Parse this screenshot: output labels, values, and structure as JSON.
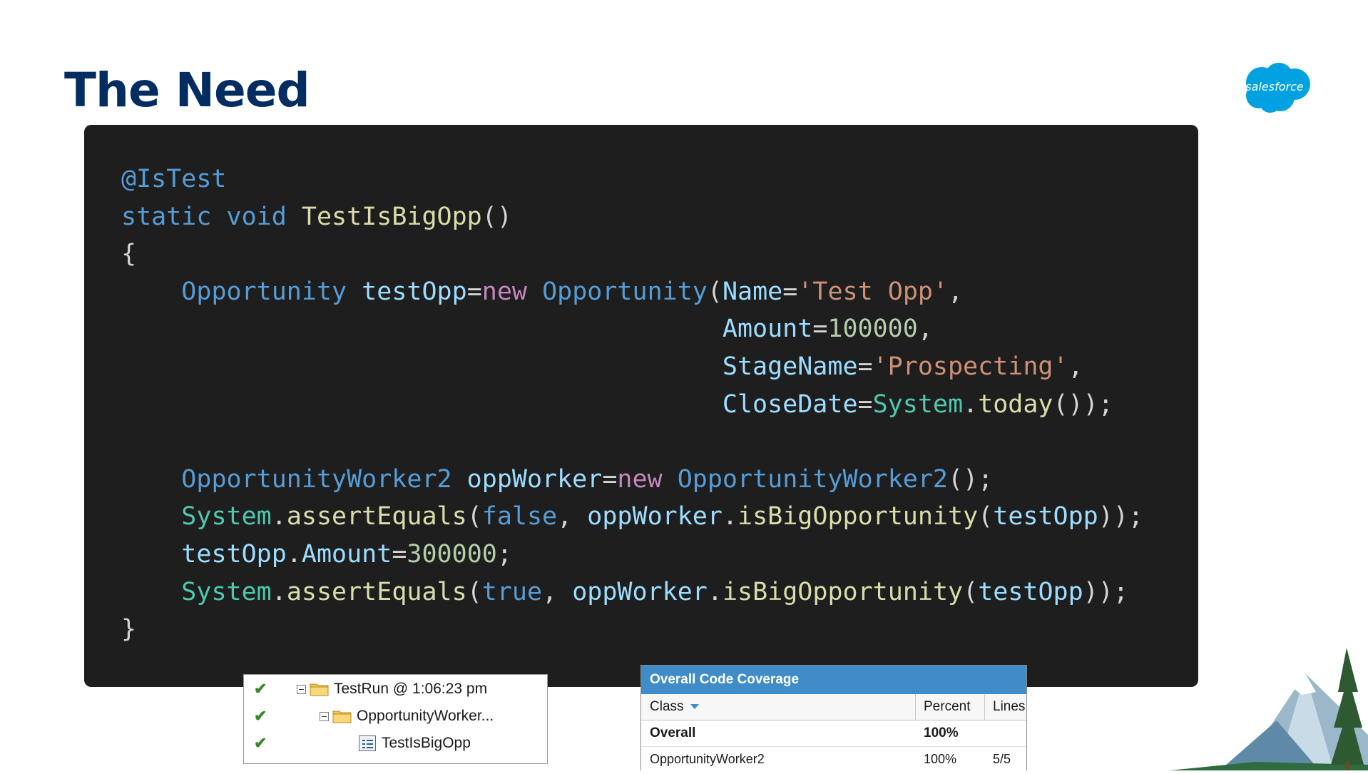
{
  "slide": {
    "title": "The Need"
  },
  "logo": {
    "text": "salesforce",
    "color": "#00a1e0"
  },
  "code": {
    "l1": {
      "a": "@IsTest"
    },
    "l2": {
      "a": "static",
      "b": " ",
      "c": "void",
      "d": " ",
      "e": "TestIsBigOpp",
      "f": "()"
    },
    "l3": {
      "a": "{"
    },
    "l4": {
      "i": "    ",
      "a": "Opportunity",
      "b": " ",
      "c": "testOpp",
      "d": "=",
      "e": "new",
      "f": " ",
      "g": "Opportunity",
      "h": "(",
      "j": "Name",
      "k": "=",
      "l": "'Test Opp'",
      "m": ","
    },
    "l5": {
      "i": "                                        ",
      "a": "Amount",
      "b": "=",
      "c": "100000",
      "d": ","
    },
    "l6": {
      "i": "                                        ",
      "a": "StageName",
      "b": "=",
      "c": "'Prospecting'",
      "d": ","
    },
    "l7": {
      "i": "                                        ",
      "a": "CloseDate",
      "b": "=",
      "c": "System",
      "d": ".",
      "e": "today",
      "f": "());"
    },
    "l8": {
      "a": ""
    },
    "l9": {
      "i": "    ",
      "a": "OpportunityWorker2",
      "b": " ",
      "c": "oppWorker",
      "d": "=",
      "e": "new",
      "f": " ",
      "g": "OpportunityWorker2",
      "h": "();"
    },
    "l10": {
      "i": "    ",
      "a": "System",
      "b": ".",
      "c": "assertEquals",
      "d": "(",
      "e": "false",
      "f": ", ",
      "g": "oppWorker",
      "h": ".",
      "j": "isBigOpportunity",
      "k": "(",
      "l": "testOpp",
      "m": "));"
    },
    "l11": {
      "i": "    ",
      "a": "testOpp",
      "b": ".",
      "c": "Amount",
      "d": "=",
      "e": "300000",
      "f": ";"
    },
    "l12": {
      "i": "    ",
      "a": "System",
      "b": ".",
      "c": "assertEquals",
      "d": "(",
      "e": "true",
      "f": ", ",
      "g": "oppWorker",
      "h": ".",
      "j": "isBigOpportunity",
      "k": "(",
      "l": "testOpp",
      "m": "));"
    },
    "l13": {
      "a": "}"
    }
  },
  "test_tree": {
    "rows": [
      {
        "label": "TestRun @ 1:06:23 pm",
        "icon": "folder-icon",
        "status": "pass"
      },
      {
        "label": "OpportunityWorker...",
        "icon": "folder-icon",
        "status": "pass"
      },
      {
        "label": "TestIsBigOpp",
        "icon": "test-method-icon",
        "status": "pass"
      }
    ],
    "check_glyph": "✔"
  },
  "coverage": {
    "title": "Overall Code Coverage",
    "columns": {
      "class": "Class",
      "percent": "Percent",
      "lines": "Lines"
    },
    "rows": [
      {
        "class": "Overall",
        "percent": "100%",
        "lines": ""
      },
      {
        "class": "OpportunityWorker2",
        "percent": "100%",
        "lines": "5/5"
      }
    ],
    "header_color": "#3f8cc9"
  },
  "theme": {
    "title_color": "#032d60",
    "code_bg": "#1e1e1e"
  }
}
